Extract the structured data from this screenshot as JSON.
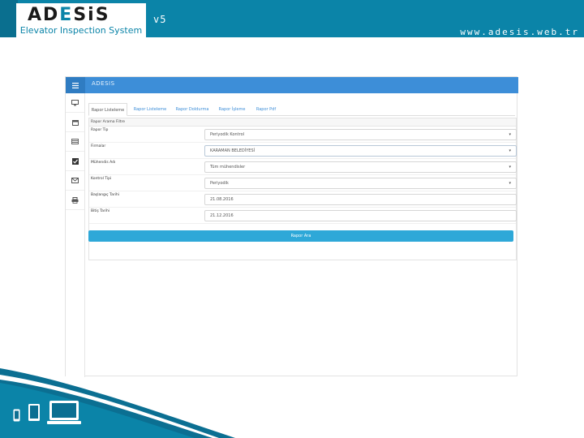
{
  "header": {
    "logo_prefix": "AD",
    "logo_accent": "E",
    "logo_suffix": "SiS",
    "tagline": "Elevator Inspection System",
    "version": "v5",
    "website": "www.adesis.web.tr"
  },
  "app": {
    "brand": "ADESIS",
    "nav_icons": [
      "monitor-icon",
      "calendar-icon",
      "list-icon",
      "checkbox-icon",
      "mail-icon",
      "printer-icon"
    ],
    "tabs": [
      {
        "label": "Rapor Listeleme",
        "active": true
      },
      {
        "label": "Rapor Listeleme",
        "active": false
      },
      {
        "label": "Rapor Doldurma",
        "active": false
      },
      {
        "label": "Rapor İşleme",
        "active": false
      },
      {
        "label": "Rapor Pdf",
        "active": false
      }
    ],
    "panel_title": "Rapor Arama Filtre",
    "filters": [
      {
        "label": "Rapor Tip",
        "value": "Periyodik Kontrol",
        "type": "select"
      },
      {
        "label": "Firmalar",
        "value": "KARAMAN BELEDİYESİ",
        "type": "select"
      },
      {
        "label": "Mühendis Adı",
        "value": "Tüm mühendisler",
        "type": "select"
      },
      {
        "label": "Kontrol Tipi",
        "value": "Periyodik",
        "type": "select"
      },
      {
        "label": "Başlangıç Tarihi",
        "value": "21.08.2016",
        "type": "date"
      },
      {
        "label": "Bitiş Tarihi",
        "value": "21.12.2016",
        "type": "date"
      }
    ],
    "search_button": "Rapor Ara"
  },
  "colors": {
    "banner": "#0b84a8",
    "topbar": "#3d8ed8",
    "button": "#2ea8d8"
  }
}
